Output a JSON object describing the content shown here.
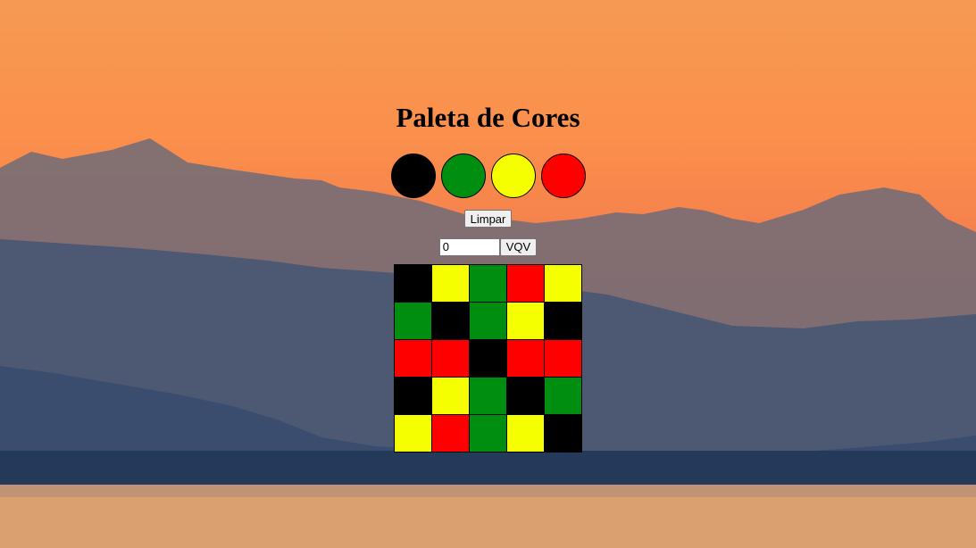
{
  "page": {
    "title": "Paleta de Cores"
  },
  "palette": {
    "colors": [
      "#000000",
      "#008e10",
      "#f5ff00",
      "#ff0000"
    ]
  },
  "controls": {
    "clear_label": "Limpar",
    "board_size_value": "0",
    "generate_label": "VQV"
  },
  "board": {
    "rows": [
      [
        "#000000",
        "#f5ff00",
        "#008e10",
        "#ff0000",
        "#f5ff00"
      ],
      [
        "#008e10",
        "#000000",
        "#008e10",
        "#f5ff00",
        "#000000"
      ],
      [
        "#ff0000",
        "#ff0000",
        "#000000",
        "#ff0000",
        "#ff0000"
      ],
      [
        "#000000",
        "#f5ff00",
        "#008e10",
        "#000000",
        "#008e10"
      ],
      [
        "#f5ff00",
        "#ff0000",
        "#008e10",
        "#f5ff00",
        "#000000"
      ]
    ]
  }
}
